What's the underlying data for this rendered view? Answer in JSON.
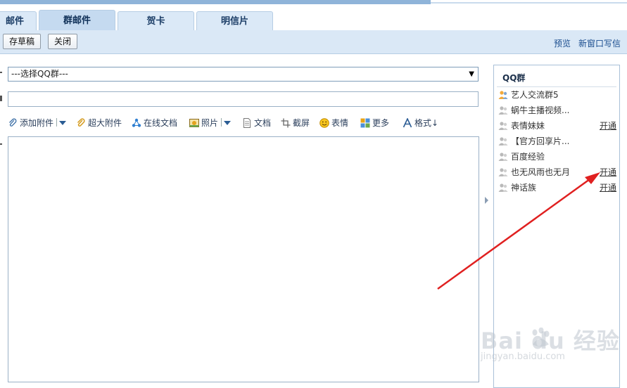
{
  "tabs": [
    {
      "label": "邮件",
      "active": false
    },
    {
      "label": "群邮件",
      "active": true
    },
    {
      "label": "贺卡",
      "active": false
    },
    {
      "label": "明信片",
      "active": false
    }
  ],
  "toolbar": {
    "save_draft": "存草稿",
    "close": "关闭",
    "preview": "预览",
    "new_window": "新窗口写信"
  },
  "compose": {
    "group_select_value": "---选择QQ群---",
    "subject_value": "",
    "body_value": ""
  },
  "tools": {
    "add_attachment": "添加附件",
    "large_attachment": "超大附件",
    "online_doc": "在线文档",
    "photo": "照片",
    "document": "文档",
    "screenshot": "截屏",
    "emoticon": "表情",
    "more": "更多",
    "format": "格式↓"
  },
  "sidebar": {
    "title": "QQ群",
    "groups": [
      {
        "name": "艺人交流群5",
        "open": "",
        "icon": "group-active-icon"
      },
      {
        "name": "蜗牛主播视频...",
        "open": "",
        "icon": "group-icon"
      },
      {
        "name": "表情妹妹",
        "open": "开通",
        "icon": "group-icon"
      },
      {
        "name": "【官方回享片...",
        "open": "",
        "icon": "group-icon"
      },
      {
        "name": "百度经验",
        "open": "",
        "icon": "group-icon"
      },
      {
        "name": "也无风雨也无月",
        "open": "开通",
        "icon": "group-icon"
      },
      {
        "name": "神话族",
        "open": "开通",
        "icon": "group-icon"
      }
    ]
  },
  "watermark": {
    "brand": "Bai  du 经验",
    "url": "jingyan.baidu.com"
  },
  "colors": {
    "tab_active": "#c5daf0",
    "toolbar_bg": "#dae8f6",
    "link": "#1a4d8f",
    "arrow": "#e02020"
  }
}
